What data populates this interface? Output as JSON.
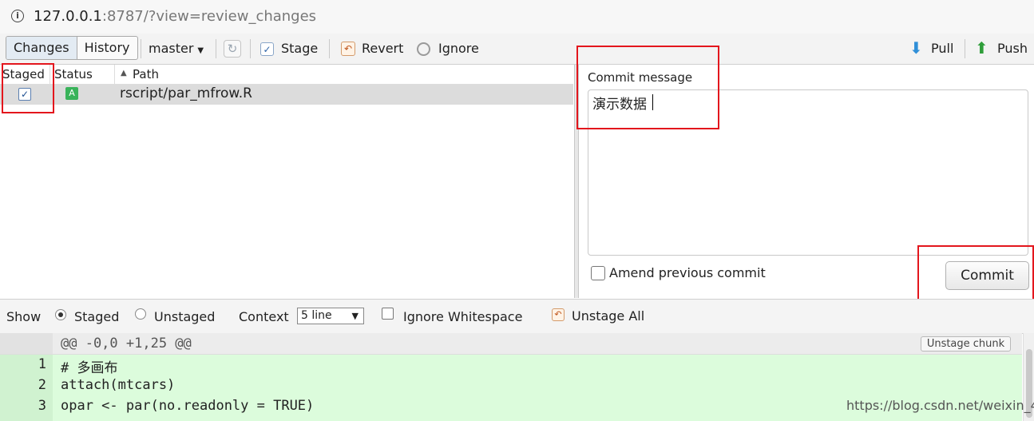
{
  "address_bar": {
    "host": "127.0.0.1",
    "rest": ":8787/?view=review_changes"
  },
  "toolbar": {
    "tab_changes": "Changes",
    "tab_history": "History",
    "branch": "master",
    "stage_label": "Stage",
    "revert_label": "Revert",
    "ignore_label": "Ignore",
    "pull_label": "Pull",
    "push_label": "Push"
  },
  "file_list": {
    "columns": [
      "Staged",
      "Status",
      "Path"
    ],
    "rows": [
      {
        "staged": true,
        "status": "A",
        "path": "rscript/par_mfrow.R"
      }
    ]
  },
  "commit": {
    "label": "Commit message",
    "message": "演示数据",
    "amend_label": "Amend previous commit",
    "commit_button": "Commit"
  },
  "diff_options": {
    "show_label": "Show",
    "staged_label": "Staged",
    "unstaged_label": "Unstaged",
    "context_label": "Context",
    "context_value": "5 line",
    "ignore_ws_label": "Ignore Whitespace",
    "unstage_all_label": "Unstage All"
  },
  "diff": {
    "hunk_header": "@@ -0,0 +1,25 @@",
    "unstage_chunk": "Unstage chunk",
    "lines": [
      {
        "num": "1",
        "text": "# 多画布"
      },
      {
        "num": "2",
        "text": "attach(mtcars)"
      },
      {
        "num": "3",
        "text": "opar <- par(no.readonly = TRUE)"
      }
    ]
  },
  "watermark": "https://blog.csdn.net/weixin_4"
}
